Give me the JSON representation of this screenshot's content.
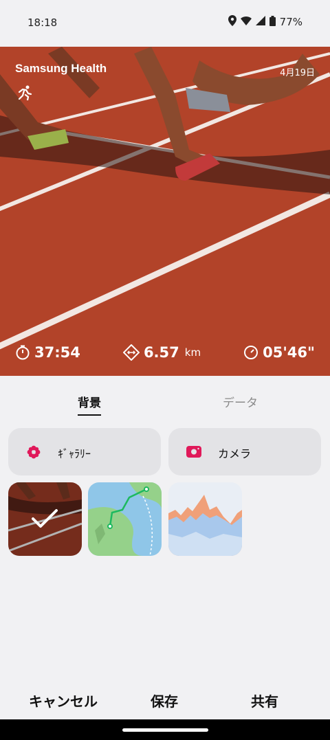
{
  "status": {
    "time": "18:18",
    "battery": "77%"
  },
  "hero": {
    "brand": "Samsung Health",
    "date": "4月19日",
    "stats": {
      "duration": "37:54",
      "distance": "6.57",
      "distance_unit": "km",
      "pace": "05'46\""
    }
  },
  "tabs": {
    "background": "背景",
    "data": "データ"
  },
  "sources": {
    "gallery": "ｷﾞｬﾗﾘｰ",
    "camera": "カメラ"
  },
  "actions": {
    "cancel": "キャンセル",
    "save": "保存",
    "share": "共有"
  },
  "colors": {
    "accent": "#e0195a",
    "track": "#b9482c"
  }
}
